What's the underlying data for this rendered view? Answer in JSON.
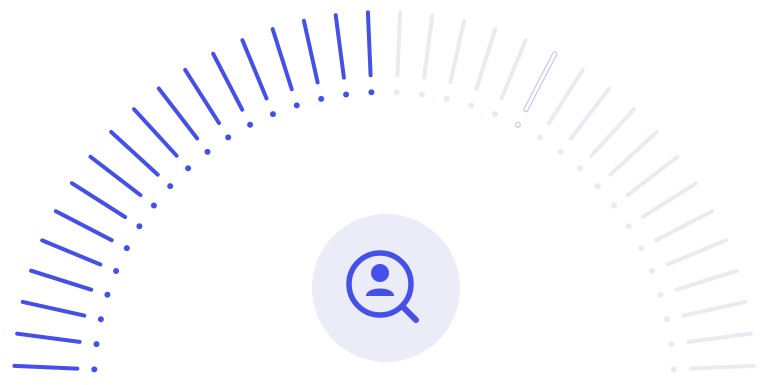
{
  "scan_progress": {
    "progress_percent": 50,
    "total_segments": 36,
    "highlighted_segment_index": 23
  },
  "icon": {
    "name": "user-search-icon"
  },
  "colors": {
    "accent": "#4450e8",
    "track": "#e9ebf3",
    "badge_bg": "#ecebf8",
    "outline_segment": "#b8c0f0"
  }
}
